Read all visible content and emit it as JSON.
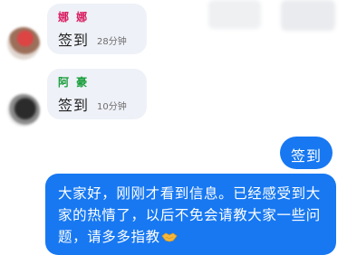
{
  "messages": [
    {
      "direction": "incoming",
      "sender": "娜 娜",
      "sender_color": "#d81b60",
      "text": "签到",
      "time": "28分钟"
    },
    {
      "direction": "incoming",
      "sender": "阿 豪",
      "sender_color": "#1a9e3d",
      "text": "签到",
      "time": "10分钟"
    },
    {
      "direction": "outgoing",
      "text": "签到"
    },
    {
      "direction": "outgoing",
      "text": "大家好，刚刚才看到信息。已经感受到大家的热情了，以后不免会请教大家一些问题，请多多指教",
      "trailing_icon": "handshake-icon"
    }
  ],
  "colors": {
    "incoming_bubble": "#eef1f7",
    "outgoing_bubble": "#1778f2"
  }
}
